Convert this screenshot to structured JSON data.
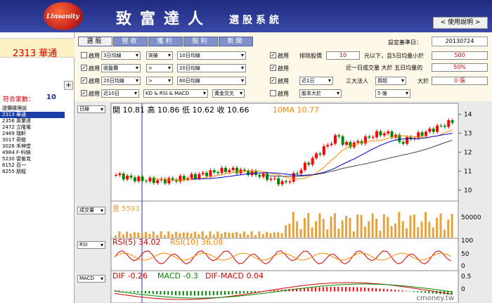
{
  "app": {
    "logo_text": "Linsanity",
    "title": "致富達人",
    "subtitle": "選股系統",
    "help_label": "< 使用說明 >"
  },
  "left_panel": {
    "stock_name": "2313 華通",
    "add_label": "+",
    "count_label": "符合家數：",
    "count_value": "10",
    "stocks": [
      "證價穩理說",
      "2313 華通",
      "2356 英業達",
      "2472 立隆電",
      "2489 瑞軒",
      "3017 奇鋐",
      "3026 禾伸堂",
      "4984 F-科納",
      "5230 雷笛克",
      "6152 百一",
      "8255 朋程"
    ],
    "selected_index": 1
  },
  "criteria": {
    "tabs": [
      "選股",
      "營收",
      "獲利",
      "股利",
      "新聞"
    ],
    "active_tab": 0,
    "base_date_label": "設定基準日：",
    "base_date": "20130724",
    "enable_label": "啟用",
    "rows": [
      {
        "checked": false,
        "sel1": "3日均線",
        "sel2": "突破",
        "sel3": "10日均線"
      },
      {
        "checked": true,
        "sel1": "收盤價",
        "sel2": ">",
        "sel3": "20日均線"
      },
      {
        "checked": true,
        "sel1": "20日均線",
        "sel2": ">",
        "sel3": "60日均線"
      },
      {
        "checked": true,
        "sel1": "近10日",
        "sel2": "KD & RSI & MACD",
        "sel3": "黃金交叉"
      }
    ],
    "right_rows": [
      {
        "checked": true,
        "label": "排除股價",
        "value": "10",
        "suffix": "元以下，且5日均量小於",
        "right_value": "500"
      },
      {
        "checked": true,
        "label": "近一日成交量 大於 五日均量的",
        "right_value": "50%"
      },
      {
        "checked": true,
        "sel1": "近1日",
        "mid_label": "三大法人",
        "sel2": "買超",
        "after": "大於",
        "right_value": "0 張"
      },
      {
        "checked": false,
        "sel1": "股本大於",
        "sel2": "5 億"
      }
    ]
  },
  "chart": {
    "period": "日線",
    "indicator1": "成交量",
    "indicator2": "RSI",
    "indicator3": "MACD",
    "price_info": "開 10.81  高 10.86  低 10.62  收 10.66",
    "ma_info": "10MA  10.77",
    "volume_info": "量 5593",
    "rsi5_info": "RSI(5) 34.02",
    "rsi10_info": "RSI(10) 36.08",
    "dif_info": "DIF -0.26",
    "macd_info": "MACD -0.3",
    "difmacd_info": "DIF-MACD 0.04",
    "watermark": "cmoney.tw",
    "price_ticks": [
      "14",
      "13",
      "12",
      "11",
      "10"
    ],
    "volume_ticks": [
      "50000"
    ],
    "rsi_ticks": [
      "100",
      "50",
      "0"
    ],
    "macd_ticks": [
      "0.5",
      "0"
    ],
    "colors": {
      "up": "#ff0000",
      "down": "#008800",
      "ma10": "#ff8800",
      "ma20": "#0000cc",
      "ma60": "#444444",
      "volume": "#e6a23c"
    }
  }
}
